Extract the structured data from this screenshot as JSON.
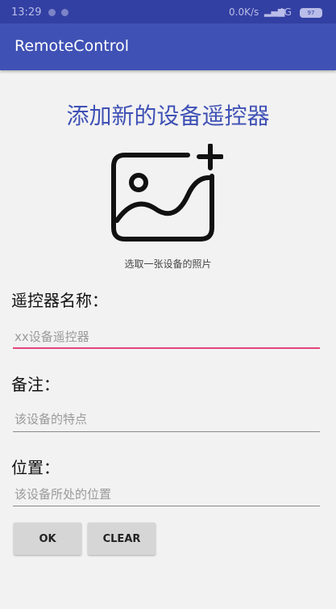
{
  "status_bar": {
    "time": "13:29",
    "network_speed": "0.0K/s",
    "network_label": "4G",
    "battery": "97"
  },
  "app_bar": {
    "title": "RemoteControl"
  },
  "heading": "添加新的设备遥控器",
  "photo_picker": {
    "caption": "选取一张设备的照片",
    "icon": "add-photo-icon"
  },
  "fields": {
    "name": {
      "label": "遥控器名称：",
      "value": "",
      "placeholder": "xx设备遥控器"
    },
    "note": {
      "label": "备注：",
      "value": "",
      "placeholder": "该设备的特点"
    },
    "location": {
      "label": "位置：",
      "value": "",
      "placeholder": "该设备所处的位置"
    }
  },
  "buttons": {
    "ok": "OK",
    "clear": "CLEAR"
  },
  "colors": {
    "primary": "#3f51b5",
    "primary_dark": "#3340a3",
    "accent": "#e0457b",
    "background": "#f2f2f2"
  }
}
